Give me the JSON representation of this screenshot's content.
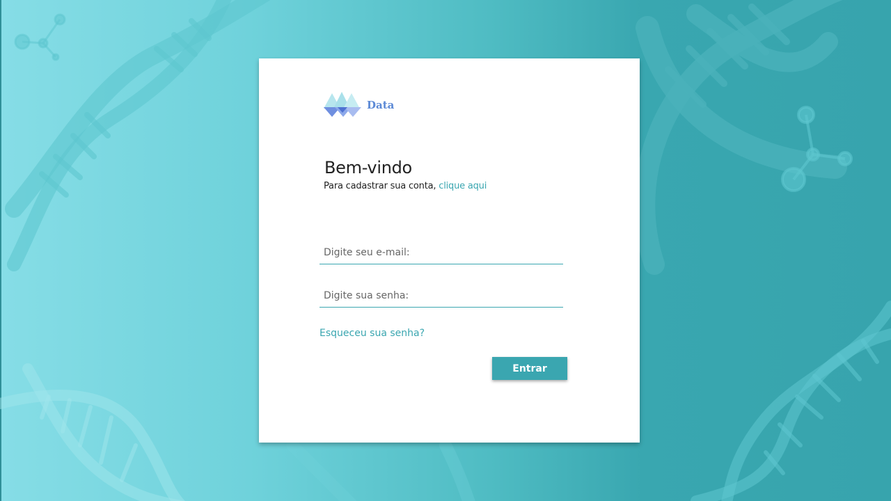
{
  "brand": {
    "name": "Data",
    "color": "#5d8ad6"
  },
  "login": {
    "title": "Bem-vindo",
    "subtitle_prefix": "Para cadastrar sua conta,",
    "register_link": "clique aqui",
    "email_placeholder": "Digite seu e-mail:",
    "password_placeholder": "Digite sua senha:",
    "forgot_link": "Esqueceu sua senha?",
    "submit_label": "Entrar"
  },
  "theme": {
    "accent": "#3aa6b0",
    "background_light": "#86dde6",
    "background_dark": "#37a4ad",
    "card": "#ffffff"
  },
  "icons": [
    "logo-triangles-icon",
    "dna-helix-icon",
    "molecule-icon"
  ]
}
